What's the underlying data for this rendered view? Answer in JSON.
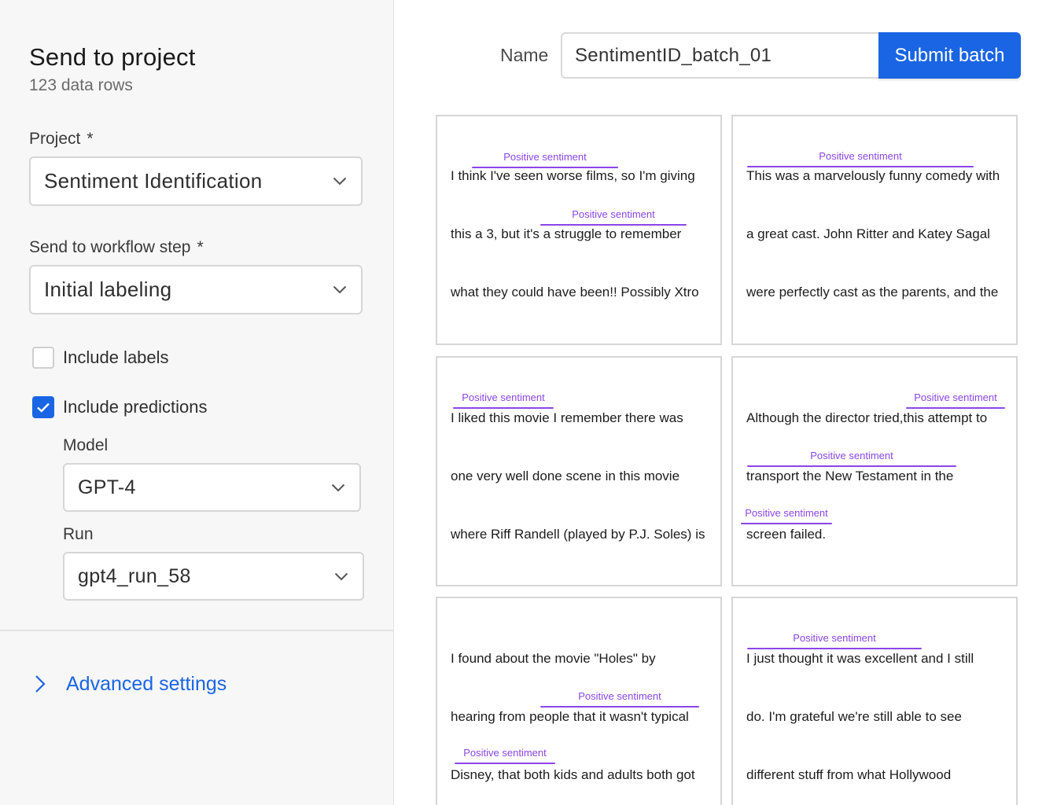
{
  "panel": {
    "title": "Send to project",
    "subtitle": "123 data rows",
    "project_label": "Project",
    "project_value": "Sentiment Identification",
    "workflow_label": "Send to workflow step",
    "workflow_value": "Initial labeling",
    "required_mark": "*",
    "include_labels": {
      "label": "Include labels",
      "checked": false
    },
    "include_predictions": {
      "label": "Include predictions",
      "checked": true
    },
    "model_label": "Model",
    "model_value": "GPT-4",
    "run_label": "Run",
    "run_value": "gpt4_run_58",
    "advanced_label": "Advanced settings"
  },
  "header": {
    "name_label": "Name",
    "name_value": "SentimentID_batch_01",
    "submit_label": "Submit batch"
  },
  "annotation_color": "#8b45e6",
  "accent_color": "#1a65e3",
  "cards": [
    {
      "lines": [
        "I think I've seen worse films, so I'm giving",
        "this a 3, but it's a struggle to remember",
        "what they could have been!! Possibly Xtro"
      ],
      "annotations": [
        {
          "label": "Positive sentiment"
        },
        {
          "label": "Positive sentiment"
        }
      ]
    },
    {
      "lines": [
        "This was a marvelously funny comedy with",
        "a great cast. John Ritter and Katey Sagal",
        "were perfectly cast as the parents, and the"
      ],
      "annotations": [
        {
          "label": "Positive sentiment"
        }
      ]
    },
    {
      "lines": [
        "I liked this movie I remember there was",
        "one very well done scene in this movie",
        "where Riff Randell (played by P.J. Soles) is"
      ],
      "annotations": [
        {
          "label": "Positive sentiment"
        }
      ]
    },
    {
      "lines": [
        "Although the director tried,this attempt to",
        "transport the New Testament in the",
        "screen failed."
      ],
      "annotations": [
        {
          "label": "Positive sentiment"
        },
        {
          "label": "Positive sentiment"
        },
        {
          "label": "Positive sentiment"
        }
      ]
    },
    {
      "lines": [
        "I found about the movie \"Holes\" by",
        "hearing from people that it wasn't typical",
        "Disney, that both kids and adults both got"
      ],
      "annotations": [
        {
          "label": "Positive sentiment"
        },
        {
          "label": "Positive sentiment"
        }
      ]
    },
    {
      "lines": [
        "I just thought it was excellent and I still",
        "do. I'm grateful we're still able to see",
        "different stuff from what Hollywood"
      ],
      "annotations": [
        {
          "label": "Positive sentiment"
        }
      ]
    }
  ]
}
